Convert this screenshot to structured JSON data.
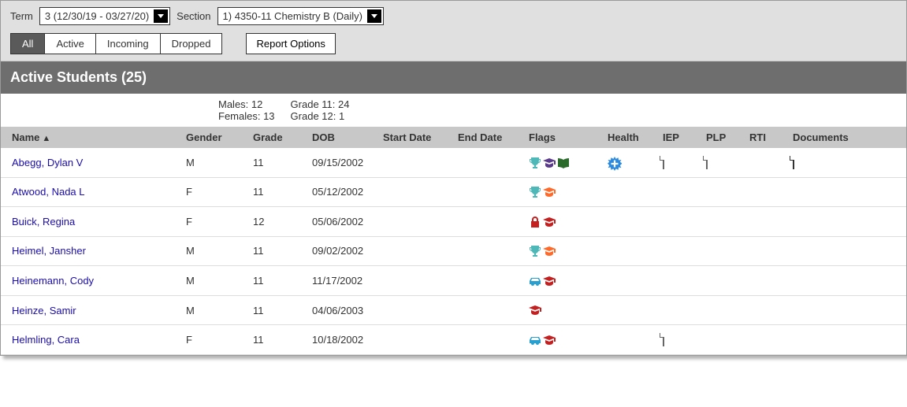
{
  "selectors": {
    "term_label": "Term",
    "term_value": "3 (12/30/19 - 03/27/20)",
    "section_label": "Section",
    "section_value": "1) 4350-11 Chemistry B (Daily)"
  },
  "tabs": {
    "all": "All",
    "active": "Active",
    "incoming": "Incoming",
    "dropped": "Dropped"
  },
  "report_options_label": "Report Options",
  "section_title": "Active Students (25)",
  "stats": {
    "males": "Males: 12",
    "females": "Females: 13",
    "grade11": "Grade 11: 24",
    "grade12": "Grade 12: 1"
  },
  "columns": {
    "name": "Name",
    "gender": "Gender",
    "grade": "Grade",
    "dob": "DOB",
    "start": "Start Date",
    "end": "End Date",
    "flags": "Flags",
    "health": "Health",
    "iep": "IEP",
    "plp": "PLP",
    "rti": "RTI",
    "docs": "Documents"
  },
  "sort_indicator": "▲",
  "rows": [
    {
      "name": "Abegg, Dylan V",
      "gender": "M",
      "grade": "11",
      "dob": "09/15/2002",
      "start": "",
      "end": "",
      "flags": [
        "trophy",
        "grad-purple",
        "book"
      ],
      "health": true,
      "iep": true,
      "plp": true,
      "rti": false,
      "docs": true
    },
    {
      "name": "Atwood, Nada L",
      "gender": "F",
      "grade": "11",
      "dob": "05/12/2002",
      "start": "",
      "end": "",
      "flags": [
        "trophy",
        "grad-orange"
      ],
      "health": false,
      "iep": false,
      "plp": false,
      "rti": false,
      "docs": false
    },
    {
      "name": "Buick, Regina",
      "gender": "F",
      "grade": "12",
      "dob": "05/06/2002",
      "start": "",
      "end": "",
      "flags": [
        "lock",
        "grad-red"
      ],
      "health": false,
      "iep": false,
      "plp": false,
      "rti": false,
      "docs": false
    },
    {
      "name": "Heimel, Jansher",
      "gender": "M",
      "grade": "11",
      "dob": "09/02/2002",
      "start": "",
      "end": "",
      "flags": [
        "trophy",
        "grad-orange"
      ],
      "health": false,
      "iep": false,
      "plp": false,
      "rti": false,
      "docs": false
    },
    {
      "name": "Heinemann, Cody",
      "gender": "M",
      "grade": "11",
      "dob": "11/17/2002",
      "start": "",
      "end": "",
      "flags": [
        "car",
        "grad-red"
      ],
      "health": false,
      "iep": false,
      "plp": false,
      "rti": false,
      "docs": false
    },
    {
      "name": "Heinze, Samir",
      "gender": "M",
      "grade": "11",
      "dob": "04/06/2003",
      "start": "",
      "end": "",
      "flags": [
        "grad-red"
      ],
      "health": false,
      "iep": false,
      "plp": false,
      "rti": false,
      "docs": false
    },
    {
      "name": "Helmling, Cara",
      "gender": "F",
      "grade": "11",
      "dob": "10/18/2002",
      "start": "",
      "end": "",
      "flags": [
        "car",
        "grad-red"
      ],
      "health": false,
      "iep": true,
      "plp": false,
      "rti": false,
      "docs": false
    }
  ]
}
